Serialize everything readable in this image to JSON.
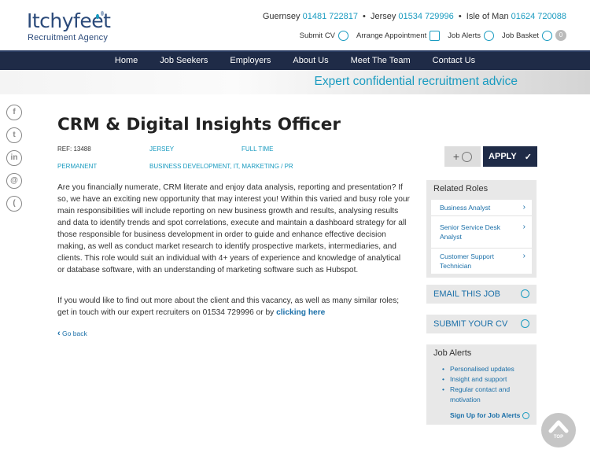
{
  "logo": {
    "main": "Itchyfeet",
    "sub": "Recruitment Agency"
  },
  "phones": {
    "guernsey_label": "Guernsey",
    "guernsey_num": "01481 722817",
    "jersey_label": "Jersey",
    "jersey_num": "01534 729996",
    "iom_label": "Isle of Man",
    "iom_num": "01624 720088",
    "sep": "•"
  },
  "utils": {
    "submit_cv": "Submit CV",
    "arrange": "Arrange Appointment",
    "alerts": "Job Alerts",
    "basket": "Job Basket",
    "basket_count": "0"
  },
  "nav": [
    "Home",
    "Job Seekers",
    "Employers",
    "About Us",
    "Meet The Team",
    "Contact Us"
  ],
  "banner": "Expert confidential recruitment advice",
  "social": [
    "f",
    "t",
    "in",
    "@",
    "("
  ],
  "job": {
    "title": "CRM & Digital Insights Officer",
    "ref": "REF: 13488",
    "location": "JERSEY",
    "hours": "FULL TIME",
    "type": "PERMANENT",
    "sectors": "BUSINESS DEVELOPMENT, IT, MARKETING / PR",
    "body": "Are you financially numerate, CRM literate and enjoy data analysis, reporting and presentation? If so, we have an exciting new opportunity that may interest you! Within this varied and busy role your main responsibilities will include reporting on new business growth and results, analysing results and data to identify trends and spot correlations, execute and maintain a dashboard strategy for all those responsible for business development in order to guide and enhance effective decision making, as well as conduct market research to identify prospective markets, intermediaries, and clients. This role would suit an individual with 4+ years of experience and knowledge of analytical or database software, with an understanding of marketing software such as Hubspot.",
    "body2_prefix": "If you would like to find out more about the client and this vacancy, as well as many similar roles; get in touch with our expert recruiters on 01534 729996 or by ",
    "body2_link": "clicking here",
    "go_back": "Go back"
  },
  "actions": {
    "add": "+",
    "apply": "APPLY",
    "check": "✓"
  },
  "related": {
    "title": "Related Roles",
    "items": [
      "Business Analyst",
      "Senior Service Desk Analyst",
      "Customer Support Technician"
    ]
  },
  "email_job": "EMAIL THIS JOB",
  "submit_cv": "SUBMIT YOUR CV",
  "alerts": {
    "title": "Job Alerts",
    "items": [
      "Personalised updates",
      "Insight and support",
      "Regular contact and motivation"
    ],
    "signup": "Sign Up for Job Alerts"
  },
  "top_label": "TOP",
  "colors": {
    "navy": "#1f2b47",
    "accent": "#1a9bc0",
    "link": "#1a6fa8",
    "panel": "#e8e8e8"
  }
}
